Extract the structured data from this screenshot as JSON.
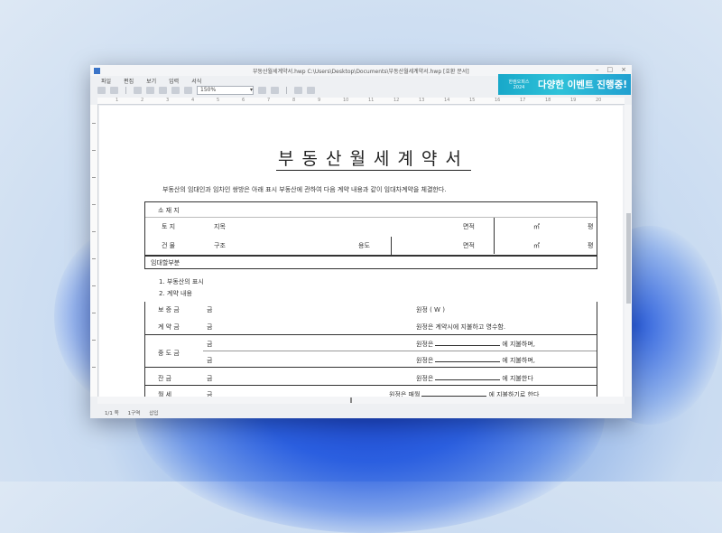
{
  "window": {
    "title": "부동산월세계약서.hwp  C:\\Users\\Desktop\\Documents\\부동산월세계약서.hwp  [호환 문서]",
    "controls": {
      "minimize": "–",
      "maximize": "□",
      "close": "×"
    }
  },
  "menu": [
    "파일",
    "편집",
    "보기",
    "입력",
    "서식"
  ],
  "toolbar": {
    "zoom_value": "150%"
  },
  "ad": {
    "small": "한컴오피스 2024",
    "text": "다양한 이벤트 진행중!"
  },
  "ruler_marks": [
    "1",
    "2",
    "3",
    "4",
    "5",
    "6",
    "7",
    "8",
    "9",
    "10",
    "11",
    "12",
    "13",
    "14",
    "15",
    "16",
    "17",
    "18",
    "19",
    "20"
  ],
  "document": {
    "title": "부동산월세계약서",
    "intro": "부동산의 임대인과 임차인 쌍방은 아래 표시 부동산에 관하여 다음 계약 내용과 같이 임대차계약을 체결한다.",
    "location_label": "소 재 지",
    "land": {
      "label": "토      지",
      "category": "지목",
      "area": "면적",
      "unit": "㎡",
      "pyeong": "평"
    },
    "building": {
      "label": "건      물",
      "structure": "구조",
      "use": "용도",
      "area": "면적",
      "unit": "㎡",
      "pyeong": "평"
    },
    "lease_part": "임대할부분",
    "list": [
      "1. 부동산의 표시",
      "2. 계약 내용"
    ],
    "payments": {
      "deposit_label": "보 증 금",
      "deposit_value": "금",
      "deposit_note": "원정 ( W                                          )",
      "contract_label": "계 약 금",
      "contract_value": "금",
      "contract_note": "원정은 계약시에 지불하고 영수함.",
      "middle_label": "중 도 금",
      "middle_value1": "금",
      "middle_note1a": "원정은",
      "middle_note1b": "에 지불하며,",
      "middle_value2": "금",
      "middle_note2a": "원정은",
      "middle_note2b": "에 지불하며,",
      "balance_label": "잔      금",
      "balance_value": "금",
      "balance_note_a": "원정은",
      "balance_note_b": "에 지불한다",
      "rent_label": "월      세",
      "rent_value": "금",
      "rent_note_a": "원정은 매월",
      "rent_note_b": "에 지불하기로 한다"
    }
  },
  "status": {
    "page": "1/1 쪽",
    "section": "1구역",
    "insert": "삽입"
  }
}
